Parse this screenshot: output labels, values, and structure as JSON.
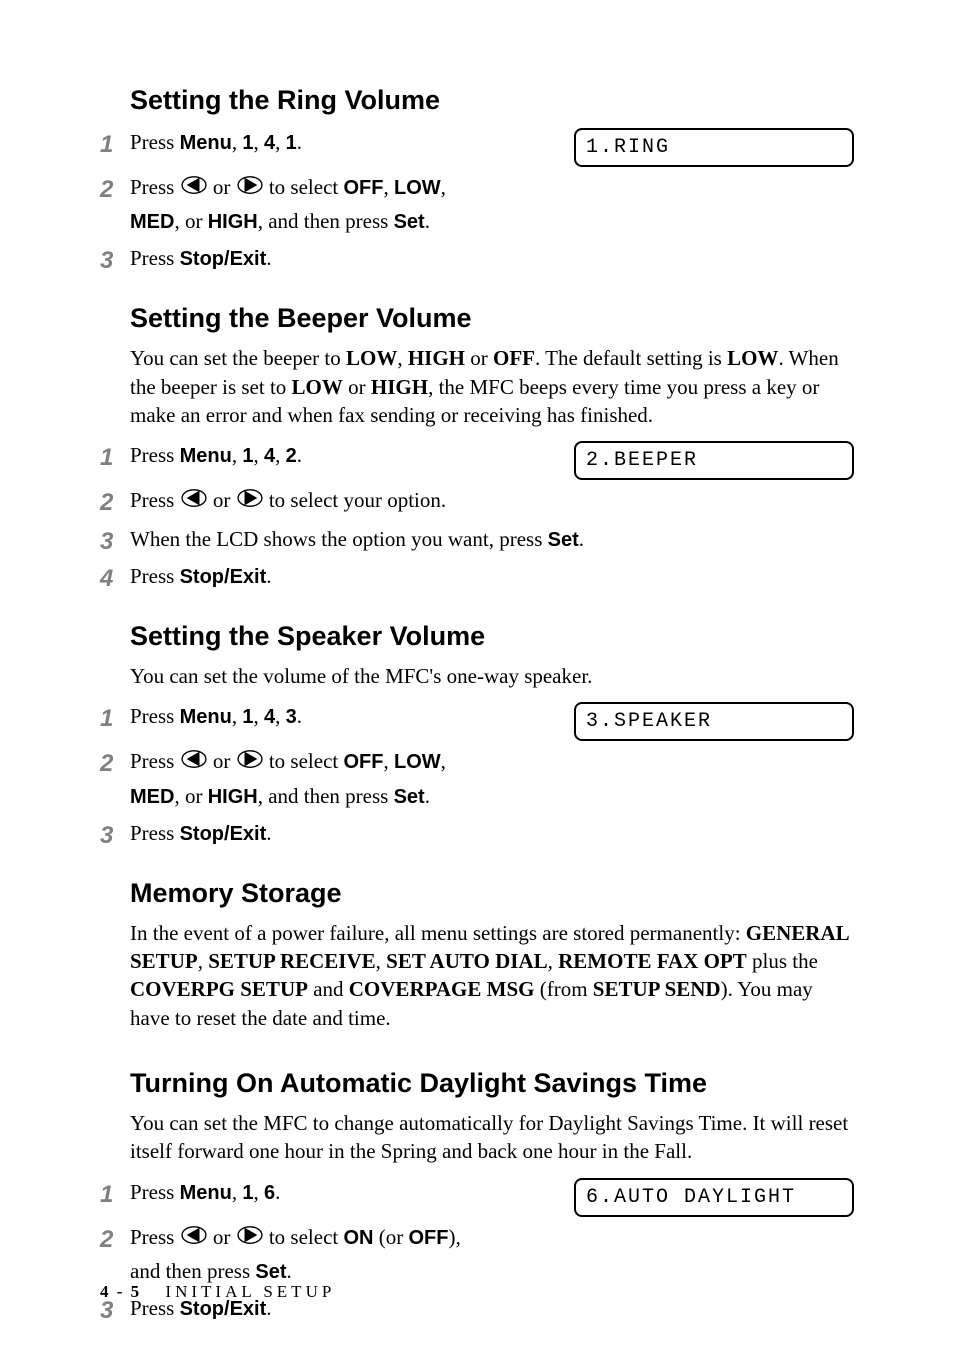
{
  "sections": [
    {
      "heading": "Setting the Ring Volume",
      "intro": "",
      "steps": [
        {
          "pre": "Press ",
          "bold1": "Menu",
          "mid": ", ",
          "bold2": "1",
          "mid2": ", ",
          "bold3": "4",
          "mid3": ", ",
          "bold4": "1",
          "post": ".",
          "lcd": "1.RING",
          "arrows": false
        },
        {
          "pre": "Press ",
          "arrows": true,
          "mid_arrows": " or ",
          "post_arrows": " to select ",
          "bold1": "OFF",
          "mid": ", ",
          "bold2": "LOW",
          "mid2": ", ",
          "line2_bold1": "MED",
          "line2_mid": ", or ",
          "line2_bold2": "HIGH",
          "line2_mid2": ", and then press ",
          "line2_bold3": "Set",
          "line2_post": "."
        },
        {
          "pre": "Press ",
          "bold1": "Stop/Exit",
          "post": "."
        }
      ]
    },
    {
      "heading": "Setting the Beeper Volume",
      "intro_parts": [
        {
          "t": "You can set the beeper to "
        },
        {
          "b": "LOW"
        },
        {
          "t": ", "
        },
        {
          "b": "HIGH"
        },
        {
          "t": " or "
        },
        {
          "b": "OFF"
        },
        {
          "t": ". The default setting is "
        },
        {
          "b": "LOW"
        },
        {
          "t": ". When the beeper is set to "
        },
        {
          "b": "LOW"
        },
        {
          "t": " or "
        },
        {
          "b": "HIGH"
        },
        {
          "t": ", the MFC beeps every time you press a key or make an error and when fax sending or receiving has finished."
        }
      ],
      "steps": [
        {
          "pre": "Press ",
          "bold1": "Menu",
          "mid": ", ",
          "bold2": "1",
          "mid2": ", ",
          "bold3": "4",
          "mid3": ", ",
          "bold4": "2",
          "post": ".",
          "lcd": "2.BEEPER",
          "arrows": false
        },
        {
          "pre": "Press ",
          "arrows": true,
          "mid_arrows": " or ",
          "post_arrows": " to select your option."
        },
        {
          "pre": "When the LCD shows the option you want, press ",
          "bold1": "Set",
          "post": "."
        },
        {
          "pre": "Press ",
          "bold1": "Stop/Exit",
          "post": "."
        }
      ]
    },
    {
      "heading": "Setting the Speaker Volume",
      "intro": "You can set the volume of the MFC's one-way speaker.",
      "steps": [
        {
          "pre": "Press ",
          "bold1": "Menu",
          "mid": ", ",
          "bold2": "1",
          "mid2": ", ",
          "bold3": "4",
          "mid3": ", ",
          "bold4": "3",
          "post": ".",
          "lcd": "3.SPEAKER",
          "arrows": false
        },
        {
          "pre": "Press ",
          "arrows": true,
          "mid_arrows": " or ",
          "post_arrows": " to select ",
          "bold1": "OFF",
          "mid": ", ",
          "bold2": "LOW",
          "mid2": ", ",
          "line2_bold1": "MED",
          "line2_mid": ", or ",
          "line2_bold2": "HIGH",
          "line2_mid2": ", and then press ",
          "line2_bold3": "Set",
          "line2_post": "."
        },
        {
          "pre": "Press ",
          "bold1": "Stop/Exit",
          "post": "."
        }
      ]
    },
    {
      "heading": "Memory Storage",
      "intro_parts": [
        {
          "t": "In the event of a power failure, all menu settings are stored permanently: "
        },
        {
          "b": "GENERAL SETUP"
        },
        {
          "t": ", "
        },
        {
          "b": "SETUP RECEIVE"
        },
        {
          "t": ", "
        },
        {
          "b": "SET AUTO DIAL"
        },
        {
          "t": ", "
        },
        {
          "b": "REMOTE FAX OPT"
        },
        {
          "t": " plus the "
        },
        {
          "b": "COVERPG SETUP"
        },
        {
          "t": " and "
        },
        {
          "b": "COVERPAGE MSG"
        },
        {
          "t": " (from "
        },
        {
          "b": "SETUP SEND"
        },
        {
          "t": "). You may have to reset the date and time."
        }
      ],
      "steps": []
    },
    {
      "heading": "Turning On Automatic Daylight Savings Time",
      "intro": "You can set the MFC to change automatically for Daylight Savings Time. It will reset itself forward one hour in the Spring and back one hour in the Fall.",
      "steps": [
        {
          "pre": "Press ",
          "bold1": "Menu",
          "mid": ", ",
          "bold2": "1",
          "mid2": ", ",
          "bold3": "6",
          "post": ".",
          "lcd": "6.AUTO DAYLIGHT",
          "arrows": false
        },
        {
          "pre": "Press ",
          "arrows": true,
          "mid_arrows": " or ",
          "post_arrows": " to select ",
          "bold1": "ON",
          "mid": " (or ",
          "bold2": "OFF",
          "mid2": "), ",
          "line2_pre": "and then press ",
          "line2_bold3": "Set",
          "line2_post": "."
        },
        {
          "pre": "Press ",
          "bold1": "Stop/Exit",
          "post": "."
        }
      ]
    }
  ],
  "footer": {
    "page": "4 - 5",
    "chapter": "INITIAL SETUP"
  }
}
